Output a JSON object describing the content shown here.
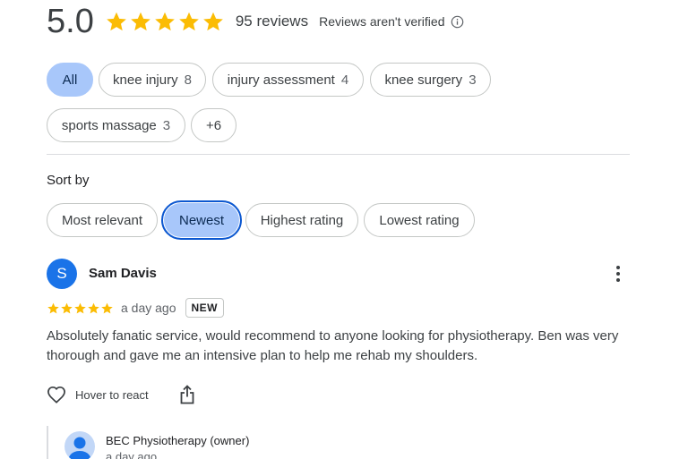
{
  "summary": {
    "score": "5.0",
    "stars": 5,
    "review_count": "95 reviews",
    "not_verified_text": "Reviews aren't verified",
    "star_color": "#fbbc04"
  },
  "filters": [
    {
      "label": "All",
      "count": "",
      "selected": true
    },
    {
      "label": "knee injury",
      "count": "8",
      "selected": false
    },
    {
      "label": "injury assessment",
      "count": "4",
      "selected": false
    },
    {
      "label": "knee surgery",
      "count": "3",
      "selected": false
    },
    {
      "label": "sports massage",
      "count": "3",
      "selected": false
    },
    {
      "label": "+6",
      "count": "",
      "selected": false
    }
  ],
  "sort": {
    "label": "Sort by",
    "options": [
      {
        "label": "Most relevant",
        "selected": false
      },
      {
        "label": "Newest",
        "selected": true
      },
      {
        "label": "Highest rating",
        "selected": false
      },
      {
        "label": "Lowest rating",
        "selected": false
      }
    ]
  },
  "review": {
    "avatar_letter": "S",
    "avatar_color": "#1a73e8",
    "reviewer_name": "Sam Davis",
    "rating": 5,
    "date": "a day ago",
    "badge": "NEW",
    "text": "Absolutely fanatic service, would recommend to anyone looking for physiotherapy. Ben was very thorough and gave me an intensive plan to help me rehab my shoulders.",
    "react_label": "Hover to react",
    "icons": {
      "more": "more-vert-icon",
      "heart": "heart-icon",
      "share": "share-icon"
    }
  },
  "owner_reply": {
    "name": "BEC Physiotherapy (owner)",
    "date": "a day ago"
  },
  "colors": {
    "accent_chip": "#a8c7fa",
    "accent_border": "#0b57d0"
  }
}
